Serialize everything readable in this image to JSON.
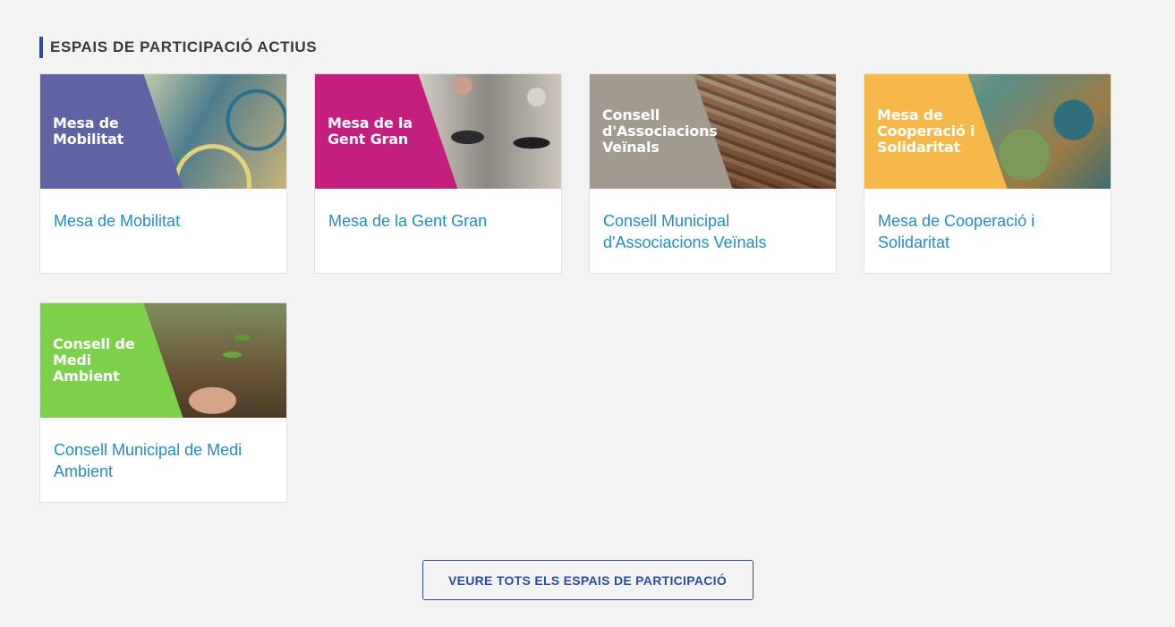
{
  "section": {
    "title": "ESPAIS DE PARTICIPACIÓ ACTIUS",
    "accent_color": "#2a4f9a"
  },
  "cards": [
    {
      "banner_text": "Mesa de\nMobilitat",
      "banner_color": "#5f63a3",
      "photo": "bicycles-photo",
      "title": "Mesa de Mobilitat"
    },
    {
      "banner_text": "Mesa de la\nGent Gran",
      "banner_color": "#c41e7e",
      "photo": "elderly-couple-photo",
      "title": "Mesa de la Gent Gran"
    },
    {
      "banner_text": "Consell\nd'Associacions\nVeïnals",
      "banner_color": "#a29a8f",
      "photo": "city-rooftops-photo",
      "title": "Consell Municipal d'Associacions Veïnals"
    },
    {
      "banner_text": "Mesa de\nCooperació i\nSolidaritat",
      "banner_color": "#f7b84a",
      "photo": "globe-photo",
      "title": "Mesa de Cooperació i Solidaritat"
    },
    {
      "banner_text": "Consell de\nMedi\nAmbient",
      "banner_color": "#7dd14a",
      "photo": "planting-photo",
      "title": "Consell Municipal de Medi Ambient"
    }
  ],
  "footer": {
    "button_label": "VEURE TOTS ELS ESPAIS DE PARTICIPACIÓ"
  },
  "colors": {
    "background": "#f3f3f3",
    "link": "#1e8ec7",
    "button_border": "#2a4f9a"
  }
}
